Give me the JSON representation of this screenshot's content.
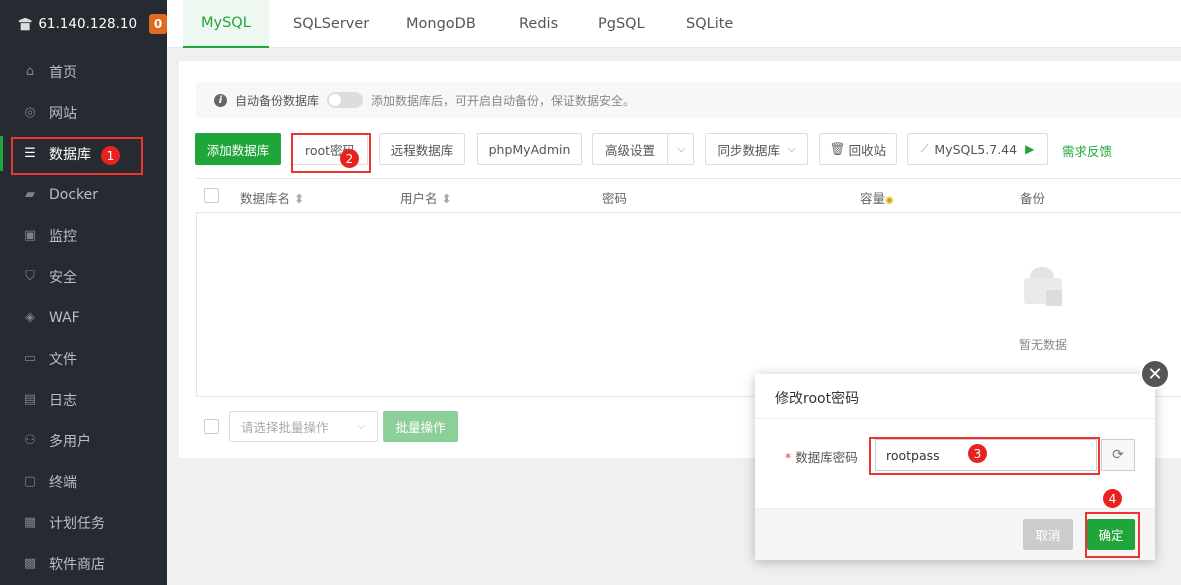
{
  "server": {
    "ip": "61.140.128.10",
    "alert_count": "0"
  },
  "sidebar": {
    "items": [
      {
        "label": "首页",
        "icon": "home-icon"
      },
      {
        "label": "网站",
        "icon": "globe-icon"
      },
      {
        "label": "数据库",
        "icon": "database-icon"
      },
      {
        "label": "Docker",
        "icon": "docker-icon"
      },
      {
        "label": "监控",
        "icon": "monitor-icon"
      },
      {
        "label": "安全",
        "icon": "shield-icon"
      },
      {
        "label": "WAF",
        "icon": "waf-icon"
      },
      {
        "label": "文件",
        "icon": "folder-icon"
      },
      {
        "label": "日志",
        "icon": "log-icon"
      },
      {
        "label": "多用户",
        "icon": "users-icon"
      },
      {
        "label": "终端",
        "icon": "terminal-icon"
      },
      {
        "label": "计划任务",
        "icon": "calendar-icon"
      },
      {
        "label": "软件商店",
        "icon": "store-icon"
      }
    ]
  },
  "tabs": [
    "MySQL",
    "SQLServer",
    "MongoDB",
    "Redis",
    "PgSQL",
    "SQLite"
  ],
  "notice": {
    "label": "自动备份数据库",
    "text": "添加数据库后，可开启自动备份，保证数据安全。"
  },
  "toolbar": {
    "add_db": "添加数据库",
    "root_password": "root密码",
    "remote_db": "远程数据库",
    "phpmyadmin": "phpMyAdmin",
    "advanced": "高级设置",
    "sync_db": "同步数据库",
    "recycle": "回收站",
    "version": "MySQL5.7.44",
    "feedback": "需求反馈"
  },
  "table": {
    "columns": [
      "数据库名",
      "用户名",
      "密码",
      "容量",
      "备份"
    ],
    "empty_text": "暂无数据"
  },
  "batch": {
    "placeholder": "请选择批量操作",
    "button": "批量操作"
  },
  "dialog": {
    "title": "修改root密码",
    "field_label": "数据库密码",
    "required_mark": "*",
    "password_value": "rootpass",
    "cancel": "取消",
    "confirm": "确定"
  },
  "annotations": [
    "1",
    "2",
    "3",
    "4"
  ],
  "colors": {
    "accent": "#20a53a",
    "sidebar_bg": "#262b31",
    "annotation": "#e8231f"
  }
}
